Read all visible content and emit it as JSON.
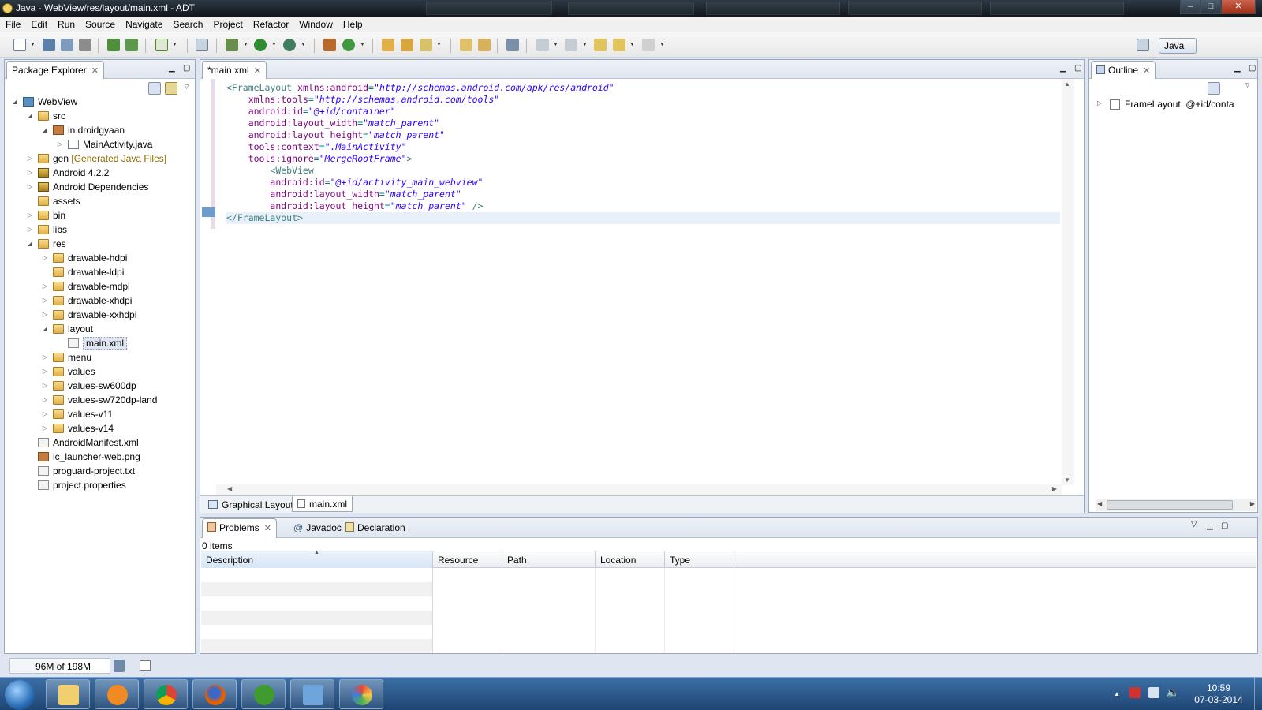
{
  "window": {
    "title": "Java - WebView/res/layout/main.xml - ADT",
    "minimize": "–",
    "maximize": "□",
    "close": "✕"
  },
  "menu": [
    "File",
    "Edit",
    "Run",
    "Source",
    "Navigate",
    "Search",
    "Project",
    "Refactor",
    "Window",
    "Help"
  ],
  "toolbar": {
    "perspective_label": "Java"
  },
  "package_explorer": {
    "tab_label": "Package Explorer",
    "tree": [
      {
        "label": "WebView",
        "icon": "project-icon",
        "twisty": "◢",
        "level": 0
      },
      {
        "label": "src",
        "icon": "folder-icon",
        "twisty": "◢",
        "level": 1
      },
      {
        "label": "in.droidgyaan",
        "icon": "package-icon",
        "twisty": "◢",
        "level": 2
      },
      {
        "label": "MainActivity.java",
        "icon": "java-file-icon",
        "twisty": "▷",
        "level": 3
      },
      {
        "label": "gen",
        "decoration": "[Generated Java Files]",
        "icon": "folder-icon",
        "twisty": "▷",
        "level": 1
      },
      {
        "label": "Android 4.2.2",
        "icon": "library-icon",
        "twisty": "▷",
        "level": 1
      },
      {
        "label": "Android Dependencies",
        "icon": "library-icon",
        "twisty": "▷",
        "level": 1
      },
      {
        "label": "assets",
        "icon": "folder-icon",
        "twisty": "",
        "level": 1
      },
      {
        "label": "bin",
        "icon": "folder-icon",
        "twisty": "▷",
        "level": 1
      },
      {
        "label": "libs",
        "icon": "folder-icon",
        "twisty": "▷",
        "level": 1
      },
      {
        "label": "res",
        "icon": "folder-icon",
        "twisty": "◢",
        "level": 1
      },
      {
        "label": "drawable-hdpi",
        "icon": "folder-icon",
        "twisty": "▷",
        "level": 2
      },
      {
        "label": "drawable-ldpi",
        "icon": "folder-icon",
        "twisty": "",
        "level": 2
      },
      {
        "label": "drawable-mdpi",
        "icon": "folder-icon",
        "twisty": "▷",
        "level": 2
      },
      {
        "label": "drawable-xhdpi",
        "icon": "folder-icon",
        "twisty": "▷",
        "level": 2
      },
      {
        "label": "drawable-xxhdpi",
        "icon": "folder-icon",
        "twisty": "▷",
        "level": 2
      },
      {
        "label": "layout",
        "icon": "folder-icon",
        "twisty": "◢",
        "level": 2
      },
      {
        "label": "main.xml",
        "icon": "xml-file-icon",
        "twisty": "",
        "level": 3,
        "selected": true
      },
      {
        "label": "menu",
        "icon": "folder-icon",
        "twisty": "▷",
        "level": 2
      },
      {
        "label": "values",
        "icon": "folder-icon",
        "twisty": "▷",
        "level": 2
      },
      {
        "label": "values-sw600dp",
        "icon": "folder-icon",
        "twisty": "▷",
        "level": 2
      },
      {
        "label": "values-sw720dp-land",
        "icon": "folder-icon",
        "twisty": "▷",
        "level": 2
      },
      {
        "label": "values-v11",
        "icon": "folder-icon",
        "twisty": "▷",
        "level": 2
      },
      {
        "label": "values-v14",
        "icon": "folder-icon",
        "twisty": "▷",
        "level": 2
      },
      {
        "label": "AndroidManifest.xml",
        "icon": "xml-file-icon",
        "twisty": "",
        "level": 1
      },
      {
        "label": "ic_launcher-web.png",
        "icon": "image-file-icon",
        "twisty": "",
        "level": 1
      },
      {
        "label": "proguard-project.txt",
        "icon": "text-file-icon",
        "twisty": "",
        "level": 1
      },
      {
        "label": "project.properties",
        "icon": "text-file-icon",
        "twisty": "",
        "level": 1
      }
    ]
  },
  "editor": {
    "tab_label": "*main.xml",
    "bottom_tabs": [
      "Graphical Layout",
      "main.xml"
    ],
    "lines": [
      [
        {
          "t": "tag",
          "v": "<FrameLayout "
        },
        {
          "t": "attr",
          "v": "xmlns:android"
        },
        {
          "t": "plain",
          "v": "="
        },
        {
          "t": "val",
          "v": "\"http://schemas.android.com/apk/res/android\""
        }
      ],
      [
        {
          "t": "plain",
          "v": "    "
        },
        {
          "t": "attr",
          "v": "xmlns:tools"
        },
        {
          "t": "plain",
          "v": "="
        },
        {
          "t": "val",
          "v": "\"http://schemas.android.com/tools\""
        }
      ],
      [
        {
          "t": "plain",
          "v": "    "
        },
        {
          "t": "attr",
          "v": "android:id"
        },
        {
          "t": "plain",
          "v": "="
        },
        {
          "t": "val",
          "v": "\"@+id/container\""
        }
      ],
      [
        {
          "t": "plain",
          "v": "    "
        },
        {
          "t": "attr",
          "v": "android:layout_width"
        },
        {
          "t": "plain",
          "v": "="
        },
        {
          "t": "val",
          "v": "\"match_parent\""
        }
      ],
      [
        {
          "t": "plain",
          "v": "    "
        },
        {
          "t": "attr",
          "v": "android:layout_height"
        },
        {
          "t": "plain",
          "v": "="
        },
        {
          "t": "val",
          "v": "\"match_parent\""
        }
      ],
      [
        {
          "t": "plain",
          "v": "    "
        },
        {
          "t": "attr",
          "v": "tools:context"
        },
        {
          "t": "plain",
          "v": "="
        },
        {
          "t": "val",
          "v": "\".MainActivity\""
        }
      ],
      [
        {
          "t": "plain",
          "v": "    "
        },
        {
          "t": "attr",
          "v": "tools:ignore"
        },
        {
          "t": "plain",
          "v": "="
        },
        {
          "t": "val",
          "v": "\"MergeRootFrame\""
        },
        {
          "t": "tag",
          "v": ">"
        }
      ],
      [
        {
          "t": "plain",
          "v": "        "
        },
        {
          "t": "tag",
          "v": "<WebView"
        }
      ],
      [
        {
          "t": "plain",
          "v": "        "
        },
        {
          "t": "attr",
          "v": "android:id"
        },
        {
          "t": "plain",
          "v": "="
        },
        {
          "t": "val",
          "v": "\"@+id/activity_main_webview\""
        }
      ],
      [
        {
          "t": "plain",
          "v": "        "
        },
        {
          "t": "attr",
          "v": "android:layout_width"
        },
        {
          "t": "plain",
          "v": "="
        },
        {
          "t": "val",
          "v": "\"match_parent\""
        }
      ],
      [
        {
          "t": "plain",
          "v": "        "
        },
        {
          "t": "attr",
          "v": "android:layout_height"
        },
        {
          "t": "plain",
          "v": "="
        },
        {
          "t": "val",
          "v": "\"match_parent\""
        },
        {
          "t": "tag",
          "v": " />"
        }
      ],
      [
        {
          "t": "tag",
          "v": "</FrameLayout>"
        }
      ]
    ],
    "highlighted_line": 11
  },
  "outline": {
    "tab_label": "Outline",
    "item_label": "FrameLayout: @+id/conta"
  },
  "problems": {
    "tabs": [
      "Problems",
      "Javadoc",
      "Declaration"
    ],
    "count_label": "0 items",
    "columns": [
      "Description",
      "Resource",
      "Path",
      "Location",
      "Type"
    ]
  },
  "status": {
    "heap": "96M of 198M"
  },
  "clock": {
    "time": "10:59",
    "date": "07-03-2014"
  },
  "colors": {
    "xml_tag": "#3f7f7f",
    "xml_attr": "#7f007f",
    "xml_value": "#2a00ff",
    "selection": "#dfe6f1"
  }
}
